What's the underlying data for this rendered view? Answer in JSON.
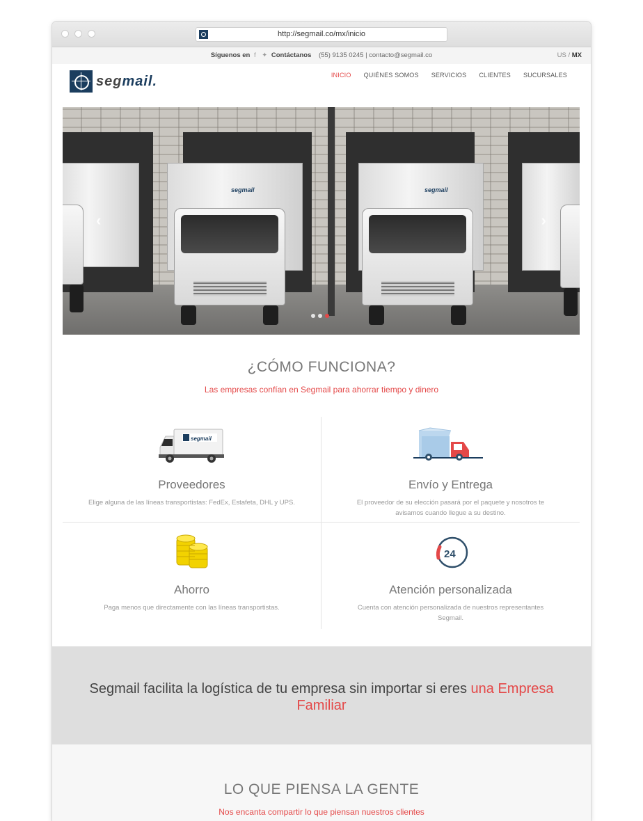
{
  "browser": {
    "url": "http://segmail.co/mx/inicio"
  },
  "topbar": {
    "follow_label": "Síguenos en",
    "contact_label": "Contáctanos",
    "phone": "(55) 9135 0245",
    "separator": "|",
    "email": "contacto@segmail.co",
    "lang_us": "US",
    "lang_sep": "/",
    "lang_mx": "MX"
  },
  "header": {
    "logo_text_a": "seg",
    "logo_text_b": "mail.",
    "nav": [
      "INICIO",
      "QUIÉNES SOMOS",
      "SERVICIOS",
      "CLIENTES",
      "SUCURSALES"
    ]
  },
  "hero": {
    "truck_brand": "segmail",
    "prev_arrow": "‹",
    "next_arrow": "›"
  },
  "how": {
    "title": "¿CÓMO FUNCIONA?",
    "subtitle": "Las empresas confían en Segmail para ahorrar tiempo y dinero",
    "items": [
      {
        "title": "Proveedores",
        "text": "Elige alguna de las líneas transportistas: FedEx, Estafeta, DHL y UPS."
      },
      {
        "title": "Envío y Entrega",
        "text": "El proveedor de su elección pasará por el paquete y nosotros te avisamos cuando llegue a su destino."
      },
      {
        "title": "Ahorro",
        "text": "Paga menos que directamente con las líneas transportistas."
      },
      {
        "title": "Atención personalizada",
        "text": "Cuenta con atención personalizada de nuestros representantes Segmail."
      }
    ],
    "icon_24": "24"
  },
  "banner": {
    "text": "Segmail facilita la logística de tu empresa sin importar si eres ",
    "highlight": "una Empresa Familiar"
  },
  "testimonials": {
    "title": "LO QUE PIENSA LA GENTE",
    "subtitle": "Nos encanta compartir lo que piensan nuestros clientes"
  },
  "colors": {
    "accent": "#e44848",
    "brand": "#1b3d5e"
  }
}
